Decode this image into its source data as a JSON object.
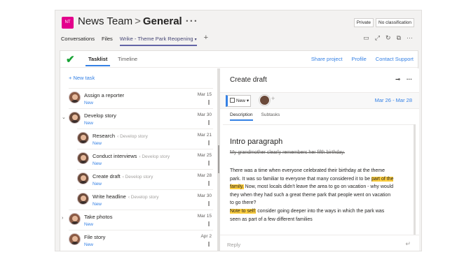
{
  "team": {
    "avatar": "NT",
    "name": "News Team",
    "separator": ">",
    "channel": "General",
    "more": "···",
    "badges": [
      "Private",
      "No classification"
    ],
    "tabs": [
      "Conversations",
      "Files",
      "Wrike - Theme Park Reopening"
    ],
    "active_tab": "Wrike - Theme Park Reopening",
    "add_tab": "+",
    "colors": {
      "avatar": "#e3008c",
      "accent": "#6264a7"
    }
  },
  "wrike": {
    "tabs": [
      "Tasklist",
      "Timeline"
    ],
    "links": [
      "Share project",
      "Profile",
      "Contact Support"
    ],
    "new_task": "+ New task",
    "colors": {
      "link": "#3581e5",
      "logo": "#18a335"
    }
  },
  "tasks": [
    {
      "name": "Assign a reporter",
      "parent": "",
      "status": "New",
      "date": "Mar 15"
    },
    {
      "name": "Develop story",
      "parent": "",
      "status": "New",
      "date": "Mar 30"
    },
    {
      "name": "Research",
      "parent": "Develop story",
      "status": "New",
      "date": "Mar 21"
    },
    {
      "name": "Conduct interviews",
      "parent": "Develop story",
      "status": "New",
      "date": "Mar 25"
    },
    {
      "name": "Create draft",
      "parent": "Develop story",
      "status": "New",
      "date": "Mar 28"
    },
    {
      "name": "Write headline",
      "parent": "Develop story",
      "status": "New",
      "date": "Mar 30"
    },
    {
      "name": "Take photos",
      "parent": "",
      "status": "New",
      "date": "Mar 15"
    },
    {
      "name": "File story",
      "parent": "",
      "status": "New",
      "date": "Apr 2"
    }
  ],
  "detail": {
    "title": "Create draft",
    "status": "New",
    "dates": "Mar 26 - Mar 28",
    "subtabs": [
      "Description",
      "Subtasks"
    ],
    "heading": "Intro paragraph",
    "struck_line": "My grandmother clearly remembers her fifth birthday.",
    "para1_a": "There was a time when everyone celebrated their birthday at the theme park. It was so familiar to everyone that many considered it to be ",
    "para1_mark": "part of the family.",
    "para1_b": " Now, most locals didn't leave the area to go on vacation - why would they when they had such a great theme park that people went on vacation to go there?",
    "para2_mark": "Note to self:",
    "para2_b": " consider going deeper into the ways in which the park was seen as part of a few different families",
    "reply_placeholder": "Reply"
  }
}
